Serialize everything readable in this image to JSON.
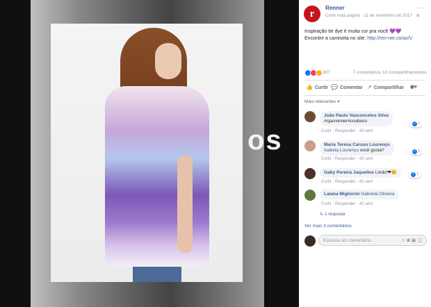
{
  "photo": {
    "background_text": "os"
  },
  "post": {
    "page_name": "Renner",
    "visibility": "Curtir esta página",
    "date": "11 de novembro de 2017",
    "message_line1": "Inspiração tie dye é muita cor pra você",
    "hearts": "💜💜",
    "message_line2_prefix": "Encontre a camiseta no site:",
    "message_link": "http://ren-ner.co/ax/V"
  },
  "stats": {
    "reaction_count": "307",
    "comments": "7 comentários",
    "shares": "10 compartilhamentos"
  },
  "actions": {
    "like": "Curtir",
    "comment": "Comentar",
    "share": "Compartilhar"
  },
  "sort_label": "Mais relevantes ▾",
  "comments": [
    {
      "author": "João Paulo Vasconcelos Silva",
      "text": "#cjacrenner#cooboco",
      "like": "Curtir",
      "reply": "Responder",
      "time": "43 sem",
      "likes": "1"
    },
    {
      "author": "Maria Teresa Caruso Lourenço",
      "mention": "Isabela Lourenço",
      "text": "você gosta?",
      "like": "Curtir",
      "reply": "Responder",
      "time": "43 sem",
      "likes": "1"
    },
    {
      "author": "Gaby Pereira Jaqueline",
      "text": "Lindo!❤😊",
      "like": "Curtir",
      "reply": "Responder",
      "time": "42 sem",
      "likes": "1"
    },
    {
      "author": "Laiana Migliorini",
      "mention": "Gabriela Oliveira",
      "text": "",
      "like": "Curtir",
      "reply": "Responder",
      "time": "42 sem",
      "likes": ""
    }
  ],
  "replies_label": "1 resposta",
  "more_comments": "Ver mais 3 comentários",
  "write": {
    "placeholder": "Escreva um comentário..."
  },
  "colors": {
    "brand": "#c4161c",
    "link": "#385898"
  }
}
